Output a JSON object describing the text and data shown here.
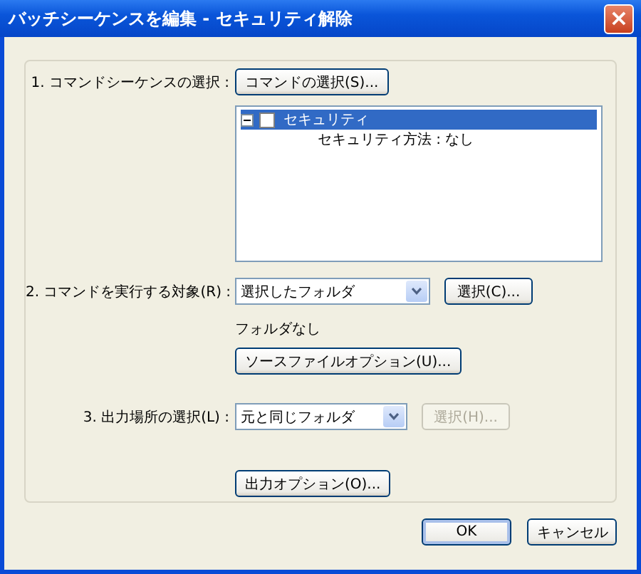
{
  "window": {
    "title": "バッチシーケンスを編集 - セキュリティ解除",
    "close": "×"
  },
  "step1": {
    "label": "1. コマンドシーケンスの選択 :",
    "button": {
      "label": "コマンドの選択(S)...",
      "disabled": false
    },
    "tree": [
      {
        "label": "セキュリティ",
        "expanded": true,
        "checked": false,
        "selected": true,
        "children": [
          {
            "label": "セキュリティ方法 : なし",
            "selected": false
          }
        ]
      }
    ]
  },
  "step2": {
    "label": "2. コマンドを実行する対象(R) :",
    "dropdown": {
      "value": "選択したフォルダ"
    },
    "button": {
      "label": "選択(C)...",
      "disabled": false
    },
    "note": "フォルダなし",
    "option_button": {
      "label": "ソースファイルオプション(U)...",
      "disabled": false
    }
  },
  "step3": {
    "label": "3. 出力場所の選択(L) :",
    "dropdown": {
      "value": "元と同じフォルダ"
    },
    "button": {
      "label": "選択(H)...",
      "disabled": true
    }
  },
  "output_button": {
    "label": "出力オプション(O)...",
    "disabled": false
  },
  "buttons": [
    {
      "label": "OK",
      "default": true
    },
    {
      "label": "キャンセル",
      "default": false
    }
  ]
}
